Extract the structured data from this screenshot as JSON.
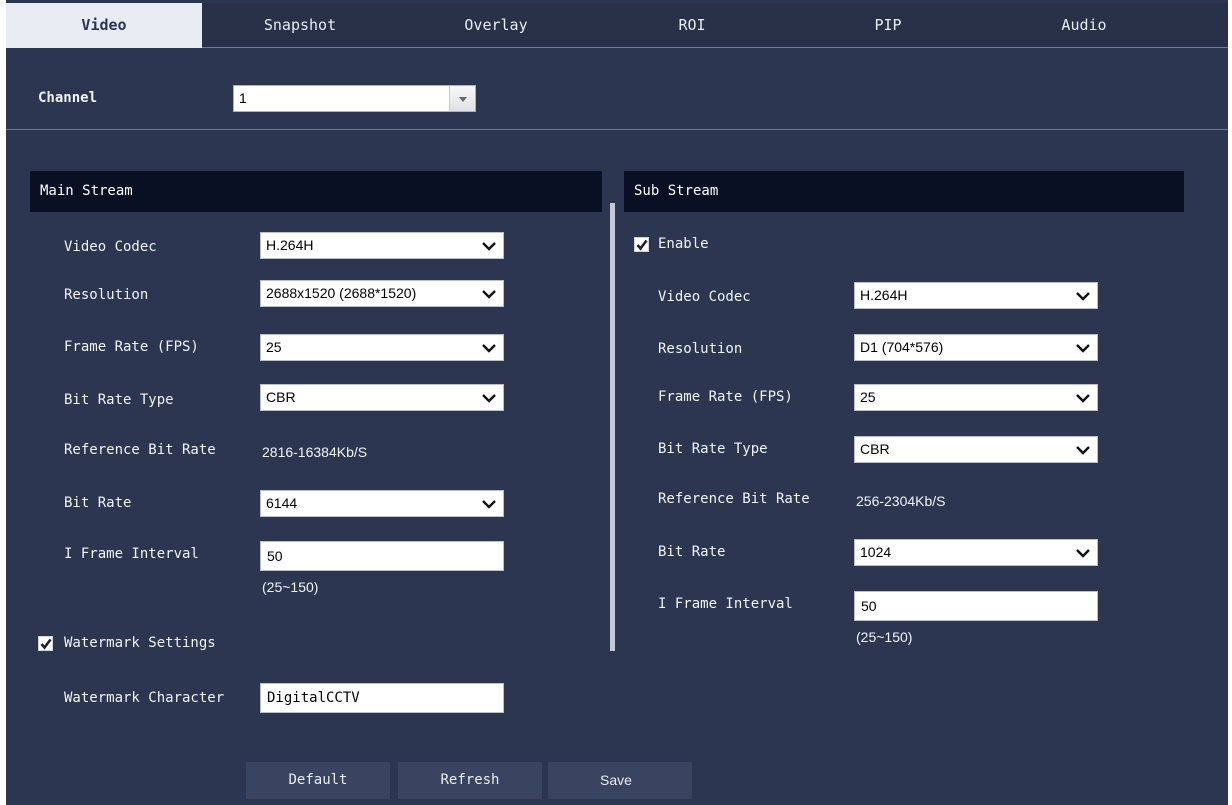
{
  "tabs": [
    "Video",
    "Snapshot",
    "Overlay",
    "ROI",
    "PIP",
    "Audio"
  ],
  "active_tab": "Video",
  "channel": {
    "label": "Channel",
    "value": "1"
  },
  "main_stream": {
    "title": "Main Stream",
    "video_codec": {
      "label": "Video Codec",
      "value": "H.264H"
    },
    "resolution": {
      "label": "Resolution",
      "value": "2688x1520 (2688*1520)"
    },
    "frame_rate": {
      "label": "Frame Rate (FPS)",
      "value": "25"
    },
    "bit_rate_type": {
      "label": "Bit Rate Type",
      "value": "CBR"
    },
    "reference_bit_rate": {
      "label": "Reference Bit Rate",
      "value": "2816-16384Kb/S"
    },
    "bit_rate": {
      "label": "Bit Rate",
      "value": "6144"
    },
    "i_frame_interval": {
      "label": "I Frame Interval",
      "value": "50",
      "range": "(25~150)"
    },
    "watermark_settings": {
      "label": "Watermark Settings",
      "checked": true
    },
    "watermark_character": {
      "label": "Watermark Character",
      "value": "DigitalCCTV"
    }
  },
  "sub_stream": {
    "title": "Sub Stream",
    "enable": {
      "label": "Enable",
      "checked": true
    },
    "video_codec": {
      "label": "Video Codec",
      "value": "H.264H"
    },
    "resolution": {
      "label": "Resolution",
      "value": "D1 (704*576)"
    },
    "frame_rate": {
      "label": "Frame Rate (FPS)",
      "value": "25"
    },
    "bit_rate_type": {
      "label": "Bit Rate Type",
      "value": "CBR"
    },
    "reference_bit_rate": {
      "label": "Reference Bit Rate",
      "value": "256-2304Kb/S"
    },
    "bit_rate": {
      "label": "Bit Rate",
      "value": "1024"
    },
    "i_frame_interval": {
      "label": "I Frame Interval",
      "value": "50",
      "range": "(25~150)"
    }
  },
  "buttons": {
    "default": "Default",
    "refresh": "Refresh",
    "save": "Save"
  },
  "colors": {
    "background": "#2c3650",
    "section_header": "#0a1024",
    "active_tab": "#e9edf3",
    "button": "#394460"
  }
}
